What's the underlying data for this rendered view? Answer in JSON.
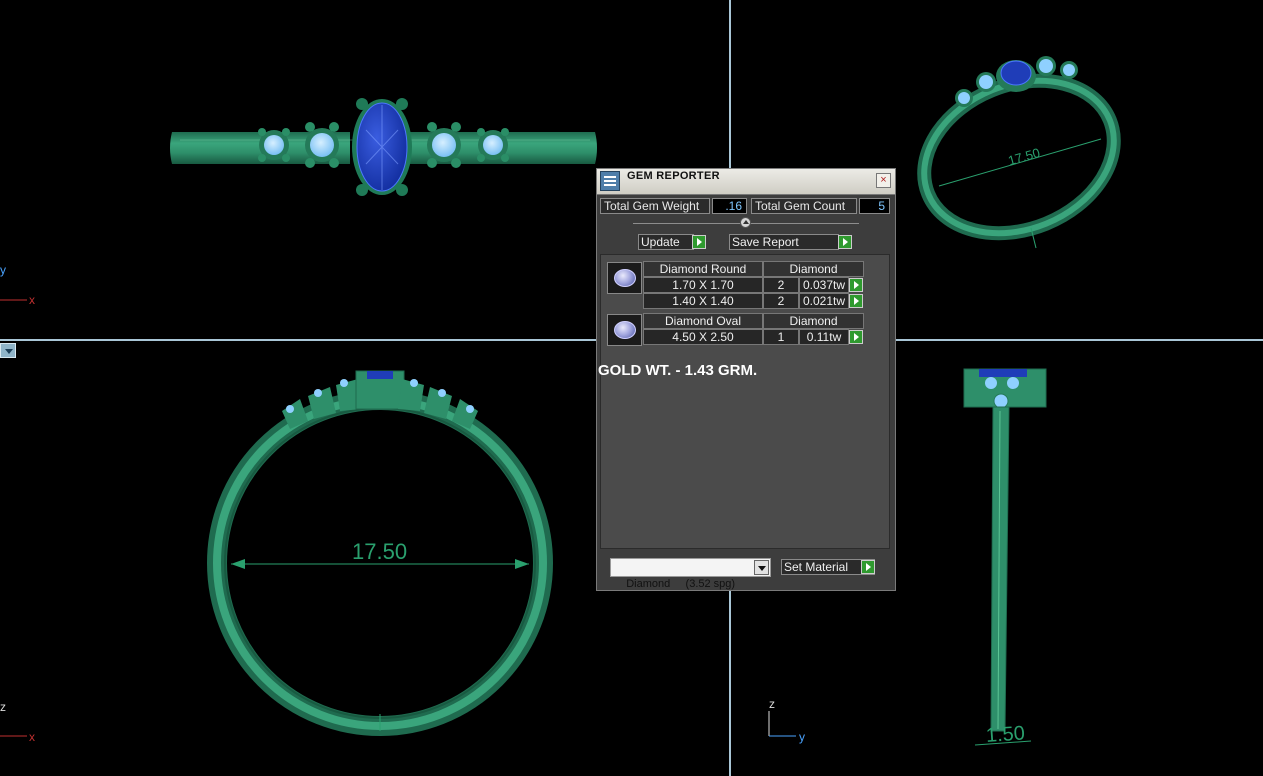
{
  "gem_reporter": {
    "title": "GEM REPORTER",
    "close_glyph": "×",
    "total_weight_label": "Total Gem Weight",
    "total_weight_value": ".16",
    "total_count_label": "Total Gem Count",
    "total_count_value": "5",
    "update_label": "Update",
    "save_report_label": "Save Report",
    "groups": [
      {
        "name": "Diamond Round",
        "material": "Diamond",
        "rows": [
          {
            "size": "1.70 X 1.70",
            "qty": "2",
            "weight": "0.037tw"
          },
          {
            "size": "1.40 X 1.40",
            "qty": "2",
            "weight": "0.021tw"
          }
        ]
      },
      {
        "name": "Diamond Oval",
        "material": "Diamond",
        "rows": [
          {
            "size": "4.50 X 2.50",
            "qty": "1",
            "weight": "0.11tw"
          }
        ]
      }
    ],
    "gold_weight_note": "GOLD WT. - 1.43 GRM.",
    "material_select_value": "Diamond     (3.52 spg)",
    "set_material_label": "Set Material"
  },
  "viewports": {
    "top_right_dimension": "17.50",
    "bottom_left_dimension": "17.50",
    "bottom_right_dimension": "1.50",
    "axis_top_left": {
      "vertical": "y",
      "horizontal": "x"
    },
    "axis_bottom_left": {
      "vertical": "z",
      "horizontal": "x"
    },
    "axis_bottom_right": {
      "vertical": "z",
      "horizontal": "y"
    }
  },
  "colors": {
    "metal": "#2e8f6a",
    "metal_dark": "#1f6b4f",
    "center_stone": "#1f3db8",
    "side_stones": "#8fd0ff",
    "dimension": "#2aa06e",
    "axis": "#c03030"
  }
}
